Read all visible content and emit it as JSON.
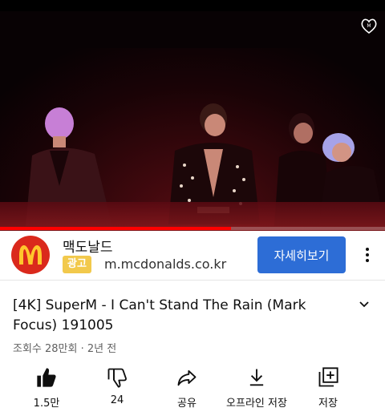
{
  "player": {
    "progress_fraction": 0.6,
    "icon": "heart-logo-icon"
  },
  "ad": {
    "advertiser": "맥도날드",
    "badge": "광고",
    "url": "m.mcdonalds.co.kr",
    "cta": "자세히보기",
    "logo_color": "#da291c",
    "cta_color": "#2d6dd6"
  },
  "video": {
    "title": "[4K] SuperM - I Can't Stand The Rain (Mark Focus) 191005",
    "meta": "조회수 28만회 · 2년 전"
  },
  "actions": [
    {
      "icon": "thumbs-up-icon",
      "label": "1.5만"
    },
    {
      "icon": "thumbs-down-icon",
      "label": "24"
    },
    {
      "icon": "share-icon",
      "label": "공유"
    },
    {
      "icon": "download-icon",
      "label": "오프라인 저장"
    },
    {
      "icon": "save-playlist-icon",
      "label": "저장"
    }
  ]
}
